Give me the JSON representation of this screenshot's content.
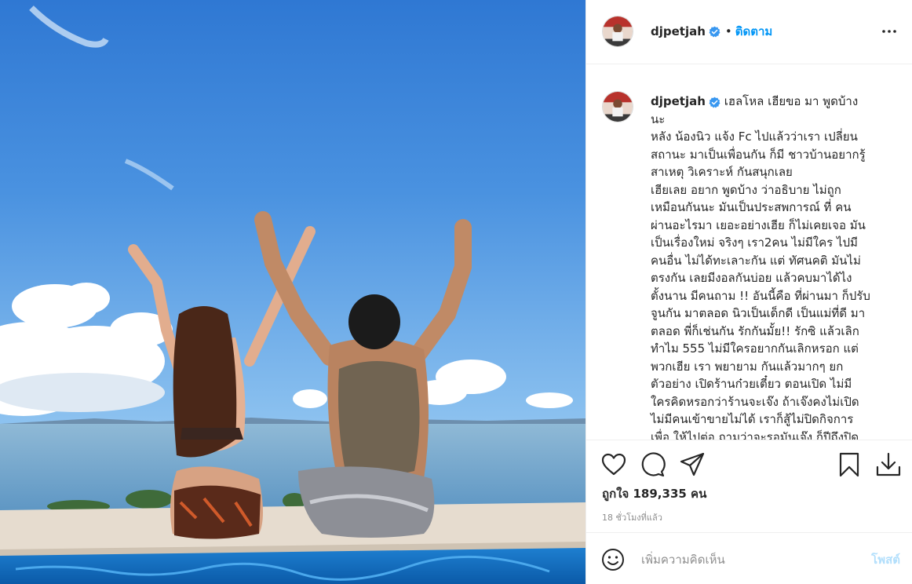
{
  "post": {
    "username": "djpetjah",
    "follow_label": "ติดตาม",
    "dot": "•"
  },
  "caption": {
    "username": "djpetjah",
    "lines": [
      "เฮลโหล เฮียขอ มา พูดบ้าง",
      "นะ",
      "หลัง น้องนิว แจ้ง Fc ไปแล้วว่าเรา เปลี่ยน",
      "สถานะ มาเป็นเพื่อนกัน ก็มี ชาวบ้านอยากรู้",
      "สาเหตุ วิเคราะห์ กันสนุกเลย",
      "เฮียเลย อยาก พูดบ้าง ว่าอธิบาย ไม่ถูก",
      "เหมือนกันนะ มันเป็นประสพการณ์ ที่ คน",
      "ผ่านอะไรมา เยอะอย่างเฮีย ก็ไม่เคยเจอ มัน",
      "เป็นเรื่องใหม่ จริงๆ เรา2คน ไม่มีใคร ไปมี",
      "คนอื่น ไม่ได้ทะเลาะกัน แต่ ทัศนคติ มันไม่",
      "ตรงกัน เลยมีงอลกันบ่อย แล้วคบมาได้ไง",
      "ตั้งนาน มีคนถาม !! อันนี้คือ ที่ผ่านมา ก็ปรับ",
      "จูนกัน มาตลอด นิวเป็นเด็กดี เป็นแม่ที่ดี มา",
      "ตลอด พี่ก็เช่นกัน รักกันมั้ย!! รักซิ แล้วเลิก",
      "ทำไม 555 ไม่มีใครอยากกันเลิกหรอก แต่",
      "พวกเฮีย เรา พยายาม กันแล้วมากๆ ยก",
      "ตัวอย่าง เปิดร้านก๋วยเตี๋ยว ตอนเปิด ไม่มี",
      "ใครคิดหรอกว่าร้านจะเจ๊ง ถ้าเจ๊งคงไม่เปิด",
      "ไม่มีคนเข้าขายไม่ได้ เราก็สู้ไม่ปิดกิจการ",
      "เพื่อ ให้ไปต่อ ถามว่าจะรอมันเจ๊ง ก็ปีถึงปิด"
    ]
  },
  "likes_text": "ถูกใจ 189,335 คน",
  "timestamp": "18 ชั่วโมงที่แล้ว",
  "comment": {
    "placeholder": "เพิ่มความคิดเห็น",
    "post_label": "โพสต์"
  },
  "colors": {
    "accent": "#0095f6",
    "verified": "#3897f0",
    "post_disabled": "#b2dffc",
    "text": "#262626",
    "muted": "#8e8e8e"
  },
  "icons": [
    "verified-badge-icon",
    "more-options-icon",
    "heart-icon",
    "comment-icon",
    "share-icon",
    "bookmark-icon",
    "download-icon",
    "emoji-icon"
  ]
}
